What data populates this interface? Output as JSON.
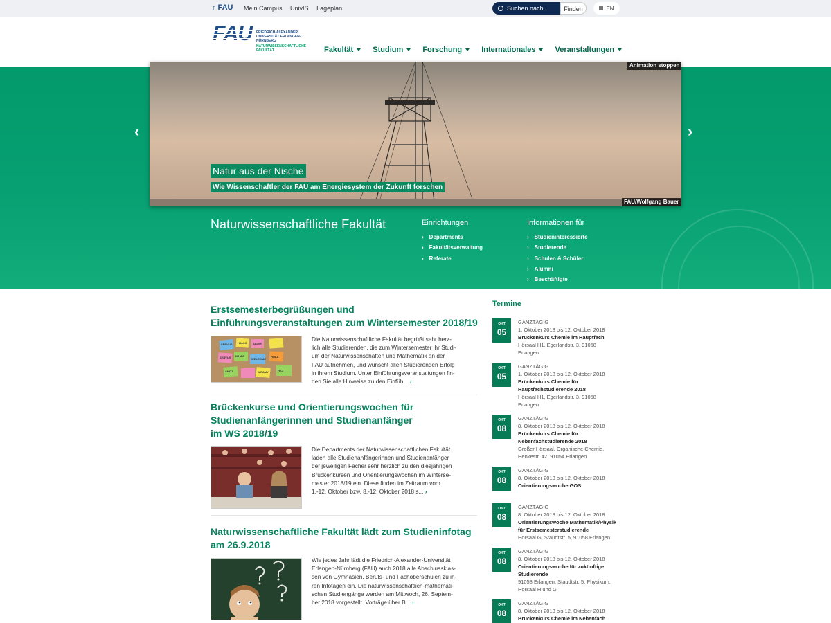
{
  "topbar": {
    "fau_link": "FAU",
    "links": [
      "Mein Campus",
      "UnivIS",
      "Lageplan"
    ],
    "search_placeholder": "Suchen nach...",
    "search_button": "Finden",
    "lang": "EN"
  },
  "logo": {
    "mark": "FAU",
    "university": "FRIEDRICH-ALEXANDER UNIVERSITÄT ERLANGEN-NÜRNBERG",
    "faculty": "NATURWISSENSCHAFTLICHE FAKULTÄT"
  },
  "nav": [
    "Fakultät",
    "Studium",
    "Forschung",
    "Internationales",
    "Veranstaltungen"
  ],
  "slider": {
    "title": "Natur aus der Nische",
    "subtitle": "Wie Wissenschaftler der FAU am Energiesystem der Zukunft forschen",
    "pause_label": "Animation stoppen",
    "credit": "FAU/Wolfgang Bauer",
    "prev": "‹",
    "next": "›"
  },
  "band": {
    "faculty_title": "Naturwissenschaftliche Fakultät",
    "einrichtungen": {
      "title": "Einrichtungen",
      "items": [
        "Departments",
        "Fakultätsverwaltung",
        "Referate"
      ]
    },
    "informationen": {
      "title": "Informationen für",
      "items": [
        "Studieninteressierte",
        "Studierende",
        "Schulen & Schüler",
        "Alumni",
        "Beschäftigte"
      ]
    }
  },
  "articles": [
    {
      "title": "Erstsemesterbegrüßungen und Einführungsveranstaltungen zum Wintersemester 2018/19",
      "lines": [
        "Die Naturwissenschaftliche Fakultät begrüßt sehr herz-",
        "lich alle Studierenden, die zum Wintersemester ihr Studi-",
        "um der Naturwissenschaften und Mathematik an der",
        "FAU aufnehmen, und wünscht allen Studierenden Erfolg",
        "in ihrem Studium. Unter Einführungsveranstaltungen fin-",
        "den Sie alle Hinweise zu den Einfüh..."
      ],
      "notes": [
        "SERVUS",
        "HALLO",
        "SALVE",
        "WELCOME",
        "HOLA",
        "NIHAO",
        "SERVUS",
        "WITAMY",
        "AHOJ",
        "HEJ"
      ]
    },
    {
      "title": "Brückenkurse und Orientierungswochen für Studienanfängerinnen und Studienanfänger im WS 2018/19",
      "lines": [
        "Die Departments der Naturwissenschaftlichen Fakultät",
        "laden alle Studienanfängerinnen und Studienanfänger",
        "der jeweiligen Fächer sehr herzlich zu den diesjährigen",
        "Brückenkursen und Orientierungswochen im Winterse-",
        "mester 2018/19 ein. Diese finden im Zeitraum vom",
        "1.-12. Oktober bzw. 8.-12. Oktober 2018 s..."
      ]
    },
    {
      "title": "Naturwissenschaftliche Fakultät lädt zum Studieninfotag am 26.9.2018",
      "lines": [
        "Wie jedes Jahr lädt die Friedrich-Alexander-Universität",
        "Erlangen-Nürnberg (FAU) auch 2018 alle Abschlussklas-",
        "sen von Gymnasien, Berufs- und Fachoberschulen zu ih-",
        "ren Infotagen ein. Die naturwissenschaftlich-mathemati-",
        "schen Studiengänge werden am Mittwoch, 26. Septem-",
        "ber 2018 vorgestellt. Vorträge über B..."
      ]
    }
  ],
  "termine": {
    "title": "Termine",
    "events": [
      {
        "month": "OKT",
        "day": "05",
        "lines": [
          "GANZTÄGIG",
          "1. Oktober 2018 bis 12. Oktober 2018"
        ],
        "title": [
          "Brückenkurs Chemie im Hauptfach"
        ],
        "location": [
          "Hörsaal H1, Egerlandstr. 3, 91058",
          "Erlangen"
        ]
      },
      {
        "month": "OKT",
        "day": "05",
        "lines": [
          "GANZTÄGIG",
          "1. Oktober 2018 bis 12. Oktober 2018"
        ],
        "title": [
          "Brückenkurs Chemie für",
          "Hauptfachstudierende 2018"
        ],
        "location": [
          "Hörsaal H1, Egerlandstr. 3, 91058",
          "Erlangen"
        ]
      },
      {
        "month": "OKT",
        "day": "08",
        "lines": [
          "GANZTÄGIG",
          "8. Oktober 2018 bis 12. Oktober 2018"
        ],
        "title": [
          "Brückenkurs Chemie für",
          "Nebenfachstudierende 2018"
        ],
        "location": [
          "Großer Hörsaal, Organische Chemie,",
          "Henkestr. 42, 91054 Erlangen"
        ]
      },
      {
        "month": "OKT",
        "day": "08",
        "lines": [
          "GANZTÄGIG",
          "8. Oktober 2018 bis 12. Oktober 2018"
        ],
        "title": [
          "Orientierungswoche GOS"
        ],
        "location": []
      },
      {
        "month": "OKT",
        "day": "08",
        "lines": [
          "GANZTÄGIG",
          "8. Oktober 2018 bis 12. Oktober 2018"
        ],
        "title": [
          "Orientierungswoche Mathematik/Physik",
          "für Erstsemesterstudierende"
        ],
        "location": [
          "Hörsaal G, Staudtstr. 5, 91058 Erlangen"
        ]
      },
      {
        "month": "OKT",
        "day": "08",
        "lines": [
          "GANZTÄGIG",
          "8. Oktober 2018 bis 12. Oktober 2018"
        ],
        "title": [
          "Orientierungswoche für zukünftige",
          "Studierende"
        ],
        "location": [
          "91058 Erlangen, Staudtstr. 5, Physikum,",
          "Hörsaal H und G"
        ]
      },
      {
        "month": "OKT",
        "day": "08",
        "lines": [
          "GANZTÄGIG",
          "8. Oktober 2018 bis 12. Oktober 2018"
        ],
        "title": [
          "Brückenkurs Chemie im Nebenfach"
        ],
        "location": []
      }
    ]
  }
}
